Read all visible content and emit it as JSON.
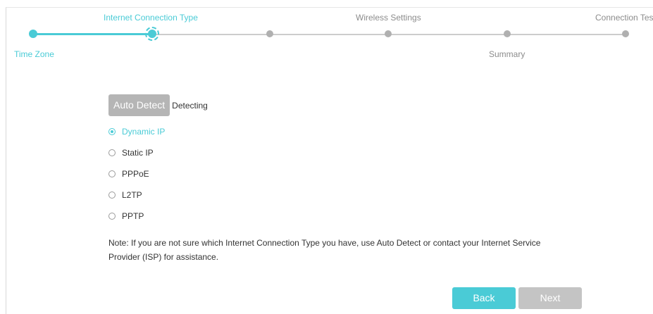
{
  "stepper": {
    "steps": [
      {
        "label": "Time Zone",
        "state": "done"
      },
      {
        "label": "Internet Connection Type",
        "state": "current"
      },
      {
        "label": "",
        "state": "todo"
      },
      {
        "label": "Wireless Settings",
        "state": "todo"
      },
      {
        "label": "Summary",
        "state": "todo"
      },
      {
        "label": "Connection Tes",
        "state": "todo"
      }
    ],
    "accent_color": "#4acbd6",
    "inactive_color": "#b0b0b0"
  },
  "form": {
    "auto_detect_label": "Auto Detect",
    "detecting_status": "Detecting",
    "options": [
      {
        "label": "Dynamic IP",
        "selected": true
      },
      {
        "label": "Static IP",
        "selected": false
      },
      {
        "label": "PPPoE",
        "selected": false
      },
      {
        "label": "L2TP",
        "selected": false
      },
      {
        "label": "PPTP",
        "selected": false
      }
    ],
    "note": "Note: If you are not sure which Internet Connection Type you have, use Auto Detect or contact your Internet Service Provider (ISP) for assistance."
  },
  "actions": {
    "back_label": "Back",
    "next_label": "Next"
  }
}
